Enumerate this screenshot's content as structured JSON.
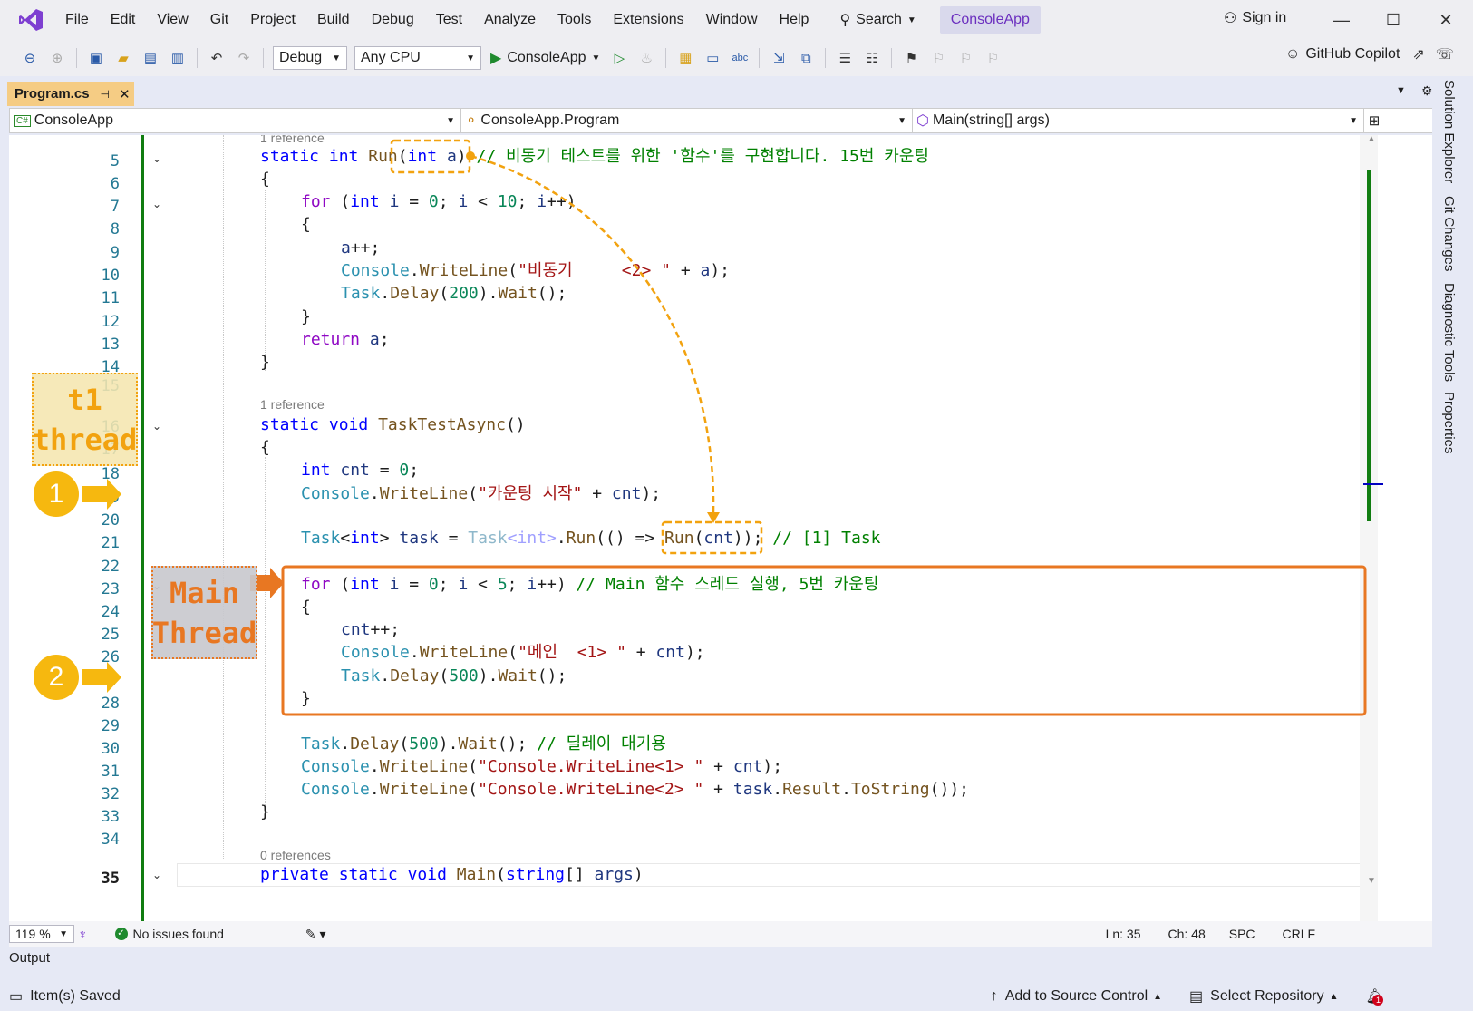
{
  "menu": {
    "items": [
      "File",
      "Edit",
      "View",
      "Git",
      "Project",
      "Build",
      "Debug",
      "Test",
      "Analyze",
      "Tools",
      "Extensions",
      "Window",
      "Help"
    ],
    "search_label": "Search",
    "solution_name": "ConsoleApp",
    "sign_in": "Sign in"
  },
  "toolbar": {
    "config": "Debug",
    "platform": "Any CPU",
    "start_target": "ConsoleApp",
    "copilot": "GitHub Copilot"
  },
  "document_tab": {
    "label": "Program.cs"
  },
  "navbar": {
    "project": "ConsoleApp",
    "type": "ConsoleApp.Program",
    "member": "Main(string[] args)"
  },
  "side_tabs": [
    "Solution Explorer",
    "Git Changes",
    "Diagnostic Tools",
    "Properties"
  ],
  "code": {
    "refs": {
      "r1": "1 reference",
      "r2": "1 reference",
      "r3": "0 references"
    },
    "line_numbers": [
      "5",
      "6",
      "7",
      "8",
      "9",
      "10",
      "11",
      "12",
      "13",
      "14",
      "15",
      "16",
      "17",
      "18",
      "19",
      "20",
      "21",
      "22",
      "23",
      "24",
      "25",
      "26",
      "27",
      "28",
      "29",
      "30",
      "31",
      "32",
      "33",
      "34",
      "35"
    ],
    "l5_comment": "// 비동기 테스트를 위한 '함수'를 구현합니다. 15번 카운팅",
    "l10_string": "\"비동기     <2> \"",
    "l19_string": "\"카운팅 시작\"",
    "l21_comment": "// [1] Task",
    "l23_comment": "// Main 함수 스레드 실행, 5번 카운팅",
    "l26_string": "\"메인  <1> \"",
    "l30_comment": "// 딜레이 대기용",
    "l31_string": "\"Console.WriteLine<1> \"",
    "l32_string": "\"Console.WriteLine<2> \""
  },
  "annotations": {
    "t1_line1": "t1",
    "t1_line2": "thread",
    "main_line1": "Main",
    "main_line2": "Thread",
    "step1": "1",
    "step2": "2"
  },
  "status": {
    "zoom": "119 %",
    "issues": "No issues found",
    "ln": "Ln: 35",
    "ch": "Ch: 48",
    "spc": "SPC",
    "crlf": "CRLF"
  },
  "output_label": "Output",
  "bottom": {
    "saved": "Item(s) Saved",
    "add_source": "Add to Source Control",
    "select_repo": "Select Repository",
    "notif_count": "1"
  },
  "colors": {
    "accent": "#6b2fbf",
    "tab_active": "#f5cc84",
    "highlight_box": "#e87722",
    "annotation_yellow": "#f6b80f",
    "change_bar": "#107c10"
  }
}
